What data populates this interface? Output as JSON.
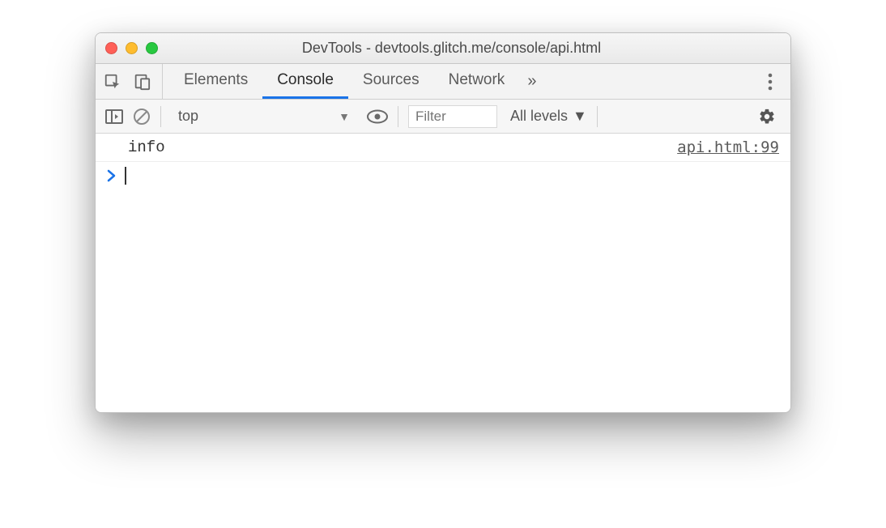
{
  "window": {
    "title": "DevTools - devtools.glitch.me/console/api.html"
  },
  "tabs": {
    "items": [
      "Elements",
      "Console",
      "Sources",
      "Network"
    ],
    "active_index": 1,
    "overflow_glyph": "»"
  },
  "filterbar": {
    "context": "top",
    "filter_placeholder": "Filter",
    "levels_label": "All levels"
  },
  "console": {
    "rows": [
      {
        "message": "info",
        "source": "api.html:99"
      }
    ],
    "prompt_glyph": "›"
  }
}
